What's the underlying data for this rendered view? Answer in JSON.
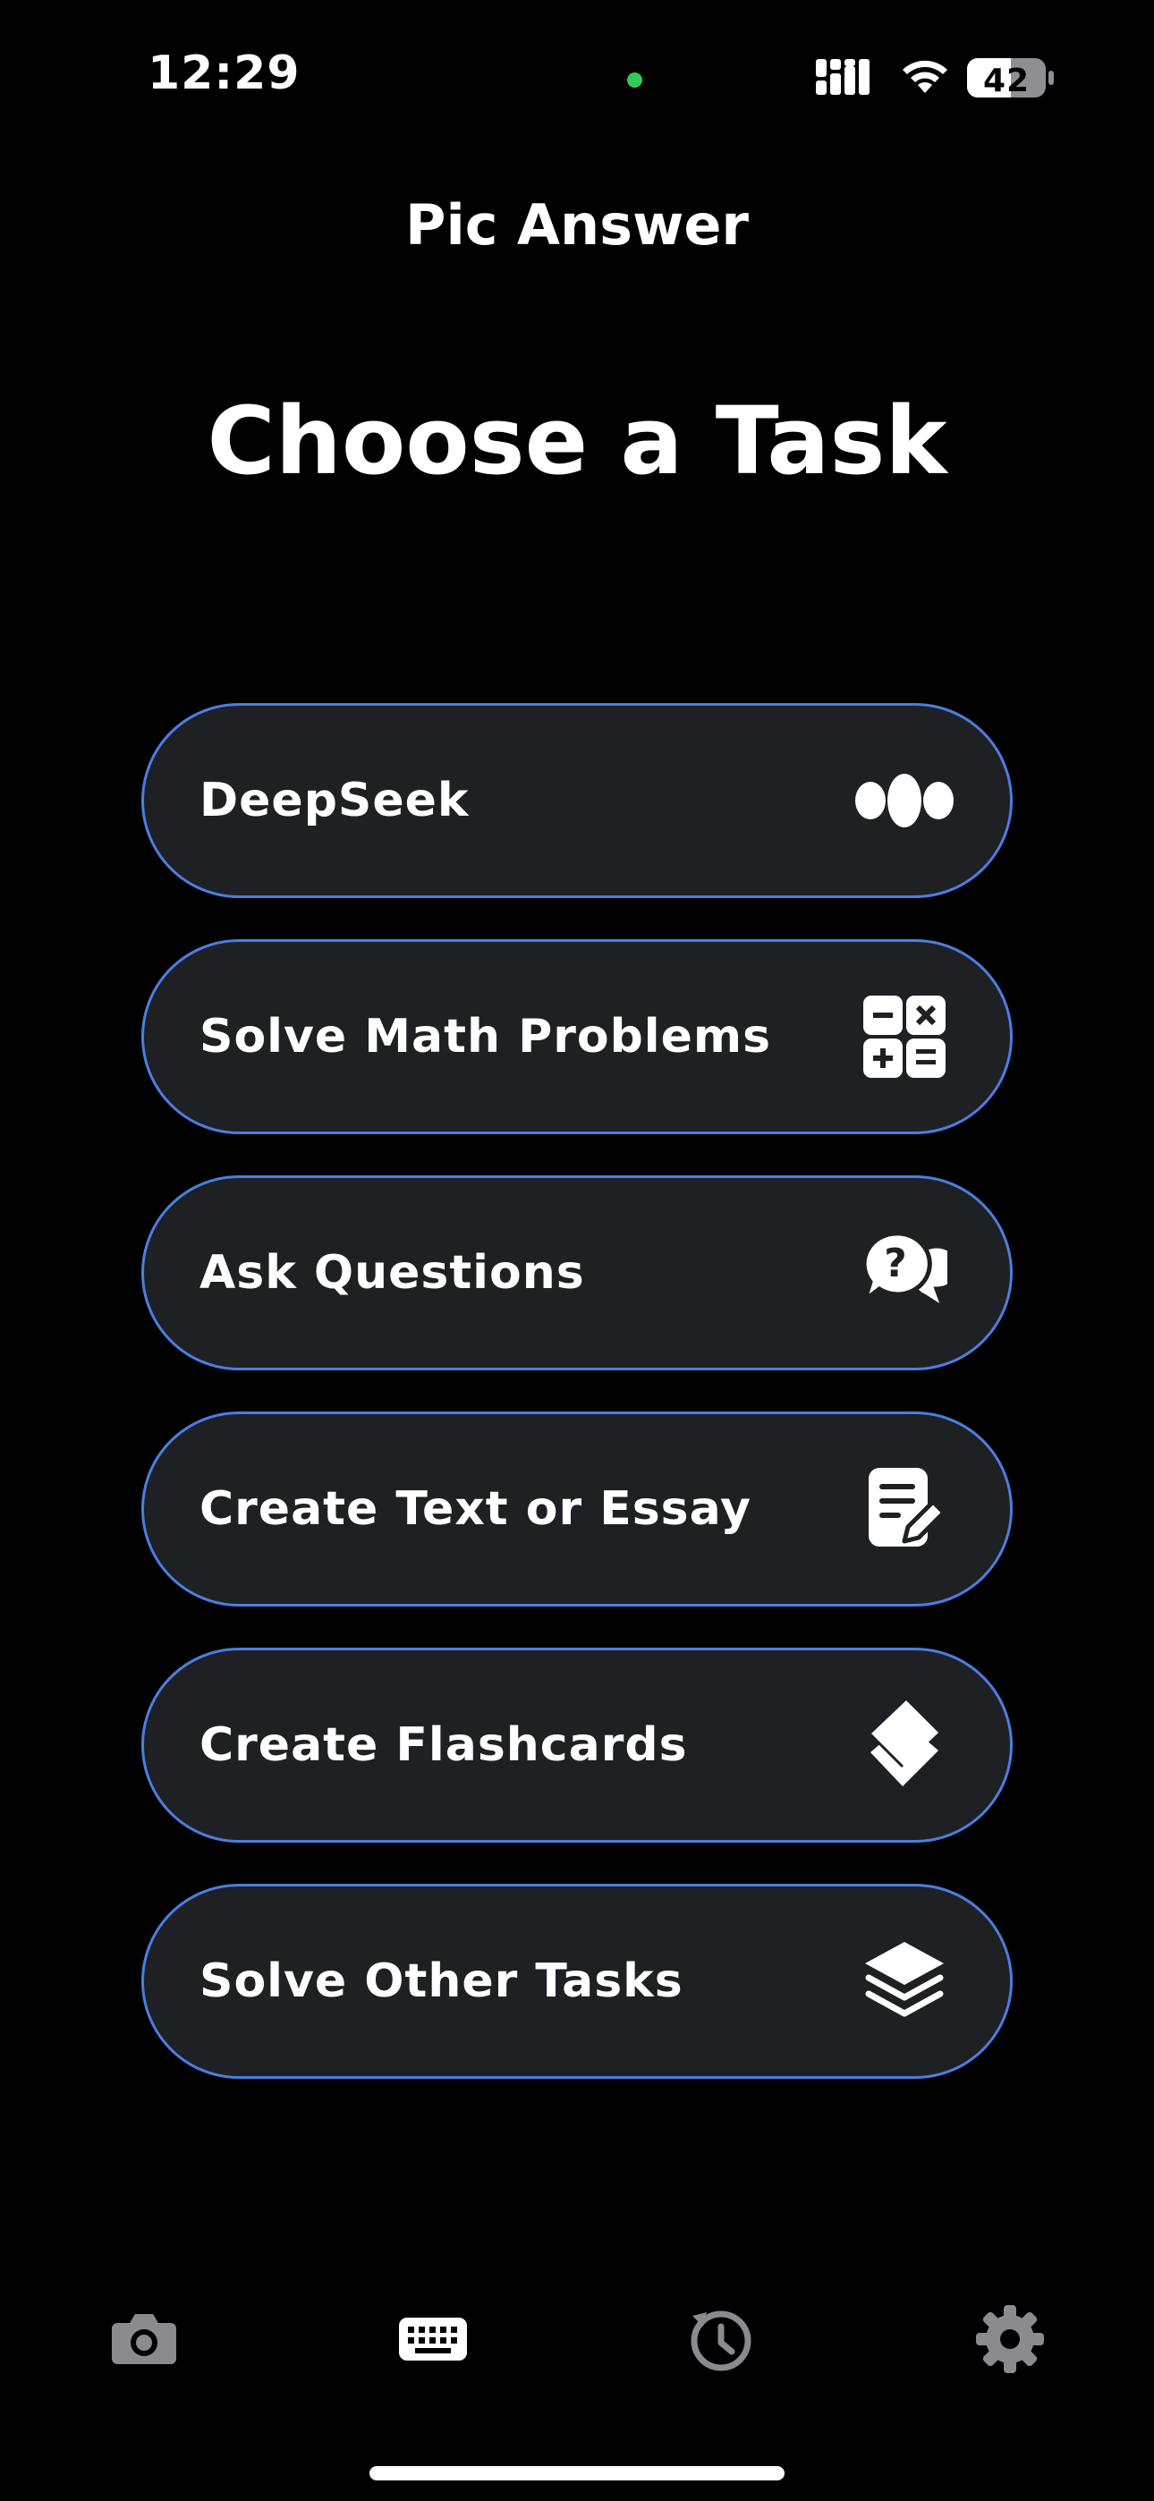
{
  "status_bar": {
    "time": "12:29",
    "battery": "42",
    "privacy_indicator_color": "#34c759"
  },
  "header": {
    "app_title": "Pic Answer",
    "page_title": "Choose a Task"
  },
  "tasks": [
    {
      "label": "DeepSeek",
      "icon": "deepseek-icon"
    },
    {
      "label": "Solve Math Problems",
      "icon": "calculator-icon"
    },
    {
      "label": "Ask Questions",
      "icon": "question-chat-icon"
    },
    {
      "label": "Create Text or Essay",
      "icon": "document-edit-icon"
    },
    {
      "label": "Create Flashcards",
      "icon": "flashcards-icon"
    },
    {
      "label": "Solve Other Tasks",
      "icon": "layers-icon"
    }
  ],
  "tab_bar": {
    "items": [
      {
        "name": "camera",
        "icon": "camera-icon",
        "active": false
      },
      {
        "name": "keyboard",
        "icon": "keyboard-icon",
        "active": true
      },
      {
        "name": "history",
        "icon": "history-icon",
        "active": false
      },
      {
        "name": "settings",
        "icon": "gear-icon",
        "active": false
      }
    ]
  },
  "colors": {
    "background": "#000000",
    "button_fill": "#1f2024",
    "button_border": "#4a7fe0",
    "text": "#ffffff",
    "tab_inactive": "#8a8a8f",
    "tab_active": "#ffffff"
  }
}
